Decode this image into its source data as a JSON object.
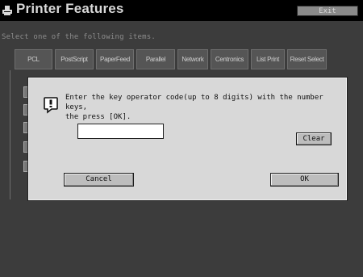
{
  "header": {
    "title": "Printer Features",
    "exit_label": "Exit"
  },
  "instruction": "Select one of the following items.",
  "tabs": [
    {
      "label": "PCL"
    },
    {
      "label": "PostScript"
    },
    {
      "label": "PaperFeed"
    },
    {
      "label": "Parallel"
    },
    {
      "label": "Network"
    },
    {
      "label": "Centronics"
    },
    {
      "label": "List Print"
    },
    {
      "label": "Reset Select"
    }
  ],
  "dialog": {
    "message": "Enter the key operator code(up to 8 digits) with the number keys,\nthe press [OK].",
    "code_value": "",
    "clear_label": "Clear",
    "cancel_label": "Cancel",
    "ok_label": "OK"
  },
  "colors": {
    "screen_bg": "#3c3c3c",
    "header_bg": "#000000",
    "dialog_bg": "#d8d8d8"
  }
}
